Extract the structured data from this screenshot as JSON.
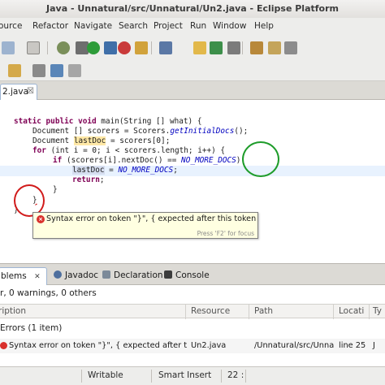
{
  "window": {
    "title": "Java - Unnatural/src/Unnatural/Un2.java - Eclipse Platform"
  },
  "menu": [
    "ource",
    "Refactor",
    "Navigate",
    "Search",
    "Project",
    "Run",
    "Window",
    "Help"
  ],
  "editor": {
    "tab_label": "2.java",
    "tab_close": "☒",
    "code": {
      "l1_kw1": "static",
      "l1_kw2": "public",
      "l1_kw3": "void",
      "l1_rest": " main(String [] what) {",
      "l2_a": "Document [] scorers = Scorers.",
      "l2_method": "getInitialDocs",
      "l2_b": "();",
      "l3_a": "Document ",
      "l3_var": "lastDoc",
      "l3_b": " = scorers[0];",
      "l4_kw": "for",
      "l4_rest": " (int i = 0; i < scorers.length; i++) {",
      "l5_kw": "if",
      "l5_a": " (scorers[i].nextDoc() == ",
      "l5_const": "NO_MORE_DOCS",
      "l5_b": ")",
      "l6_var": "lastDoc",
      "l6_a": " = ",
      "l6_const": "NO_MORE_DOCS",
      "l6_b": ";",
      "l7_kw": "return",
      "l7_b": ";",
      "l8": "}",
      "l9": "}",
      "l10": "}"
    },
    "tooltip": {
      "message": "Syntax error on token \"}\", { expected after this token",
      "hint": "Press 'F2' for focus"
    }
  },
  "views": {
    "tabs": [
      {
        "label": "blems",
        "close": "✕"
      },
      {
        "label": "Javadoc"
      },
      {
        "label": "Declaration"
      },
      {
        "label": "Console"
      }
    ],
    "problems": {
      "summary": "r, 0 warnings, 0 others",
      "columns": [
        "ription",
        "Resource",
        "Path",
        "Locati",
        "Ty"
      ],
      "group_label": "Errors (1 item)",
      "rows": [
        {
          "description": "Syntax error on token \"}\", { expected after t",
          "resource": "Un2.java",
          "path": "/Unnatural/src/Unna",
          "location": "line 25",
          "type": "J"
        }
      ]
    }
  },
  "status": {
    "writable": "Writable",
    "insert_mode": "Smart Insert",
    "position": "22 :"
  },
  "colors": {
    "error": "#d9302c",
    "keyword": "#7f0055",
    "annotation_green": "#1e9c2a",
    "annotation_red": "#d11b1b"
  }
}
